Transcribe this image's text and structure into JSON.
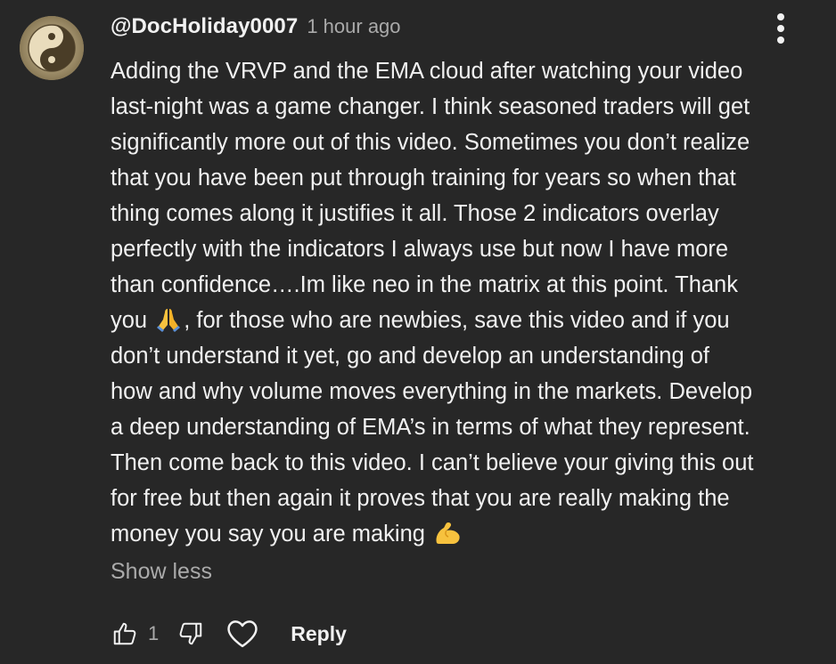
{
  "comment": {
    "author": "@DocHoliday0007",
    "timestamp": "1 hour ago",
    "avatar_icon": "yin-yang-avatar",
    "lines": [
      "Adding the VRVP and the EMA cloud after watching your video",
      "last-night was a game changer. I think seasoned traders will get",
      "significantly more out of this video. Sometimes you don’t realize",
      "that you have been put through training for years so when that",
      "thing comes along it justifies it all. Those 2 indicators overlay",
      "perfectly with the indicators I always use but now I have more",
      "than confidence….Im like neo in the matrix at this point. Thank"
    ],
    "line8_before_emoji": "you ",
    "line8_emoji": "🙏",
    "line8_after_emoji": ", for those who are newbies, save this video and if you",
    "lines_after": [
      "don’t understand it yet, go and develop an understanding of",
      "how and why volume moves everything in the markets. Develop",
      "a deep understanding of EMA’s in terms of what they represent.",
      "Then come back to this video. I can’t believe your giving this out",
      "for free but then again it proves that you are really making the"
    ],
    "last_line_text": "money you say you are making ",
    "last_line_emoji": "💪",
    "show_less_label": "Show less"
  },
  "actions": {
    "like_count": "1",
    "reply_label": "Reply",
    "like_icon": "thumbs-up-icon",
    "dislike_icon": "thumbs-down-icon",
    "heart_icon": "heart-icon",
    "menu_icon": "more-vertical-icon"
  },
  "colors": {
    "background": "#272727",
    "text_primary": "#f1f1f1",
    "text_secondary": "#aaaaaa",
    "emoji_yellow": "#f7c23e"
  }
}
